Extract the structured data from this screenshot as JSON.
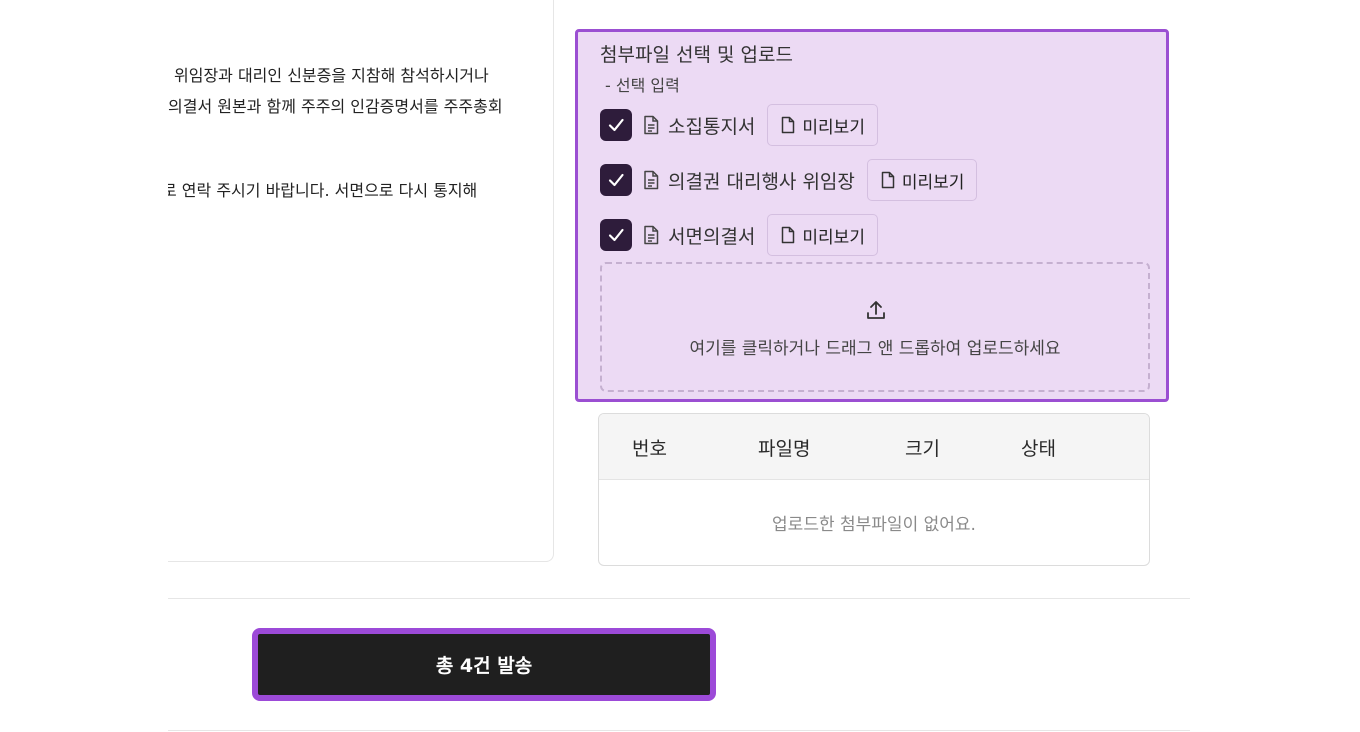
{
  "notice": {
    "lines": [
      "위임장과 대리인 신분증을 지참해 참석하시거나",
      "의결서 원본과 함께 주주의 인감증명서를 주주총회",
      "로 연락 주시기 바랍니다. 서면으로 다시 통지해"
    ]
  },
  "attachments": {
    "title": "첨부파일 선택 및 업로드",
    "subtitle": "- 선택 입력",
    "files": [
      {
        "label": "소집통지서",
        "checked": true,
        "preview_label": "미리보기"
      },
      {
        "label": "의결권 대리행사 위임장",
        "checked": true,
        "preview_label": "미리보기"
      },
      {
        "label": "서면의결서",
        "checked": true,
        "preview_label": "미리보기"
      }
    ],
    "dropzone_text": "여기를 클릭하거나 드래그 앤 드롭하여 업로드하세요"
  },
  "file_table": {
    "columns": [
      "번호",
      "파일명",
      "크기",
      "상태"
    ],
    "empty_message": "업로드한 첨부파일이 없어요."
  },
  "send_button": {
    "label": "총 4건 발송"
  },
  "colors": {
    "accent": "#9b4fd2",
    "panel_bg": "#ecdaf4",
    "checkbox": "#2e1c3b",
    "button_bg": "#1f1f1f"
  },
  "icons": {
    "file_row": "document-icon",
    "preview": "file-icon",
    "check": "check-icon",
    "upload": "upload-icon"
  }
}
